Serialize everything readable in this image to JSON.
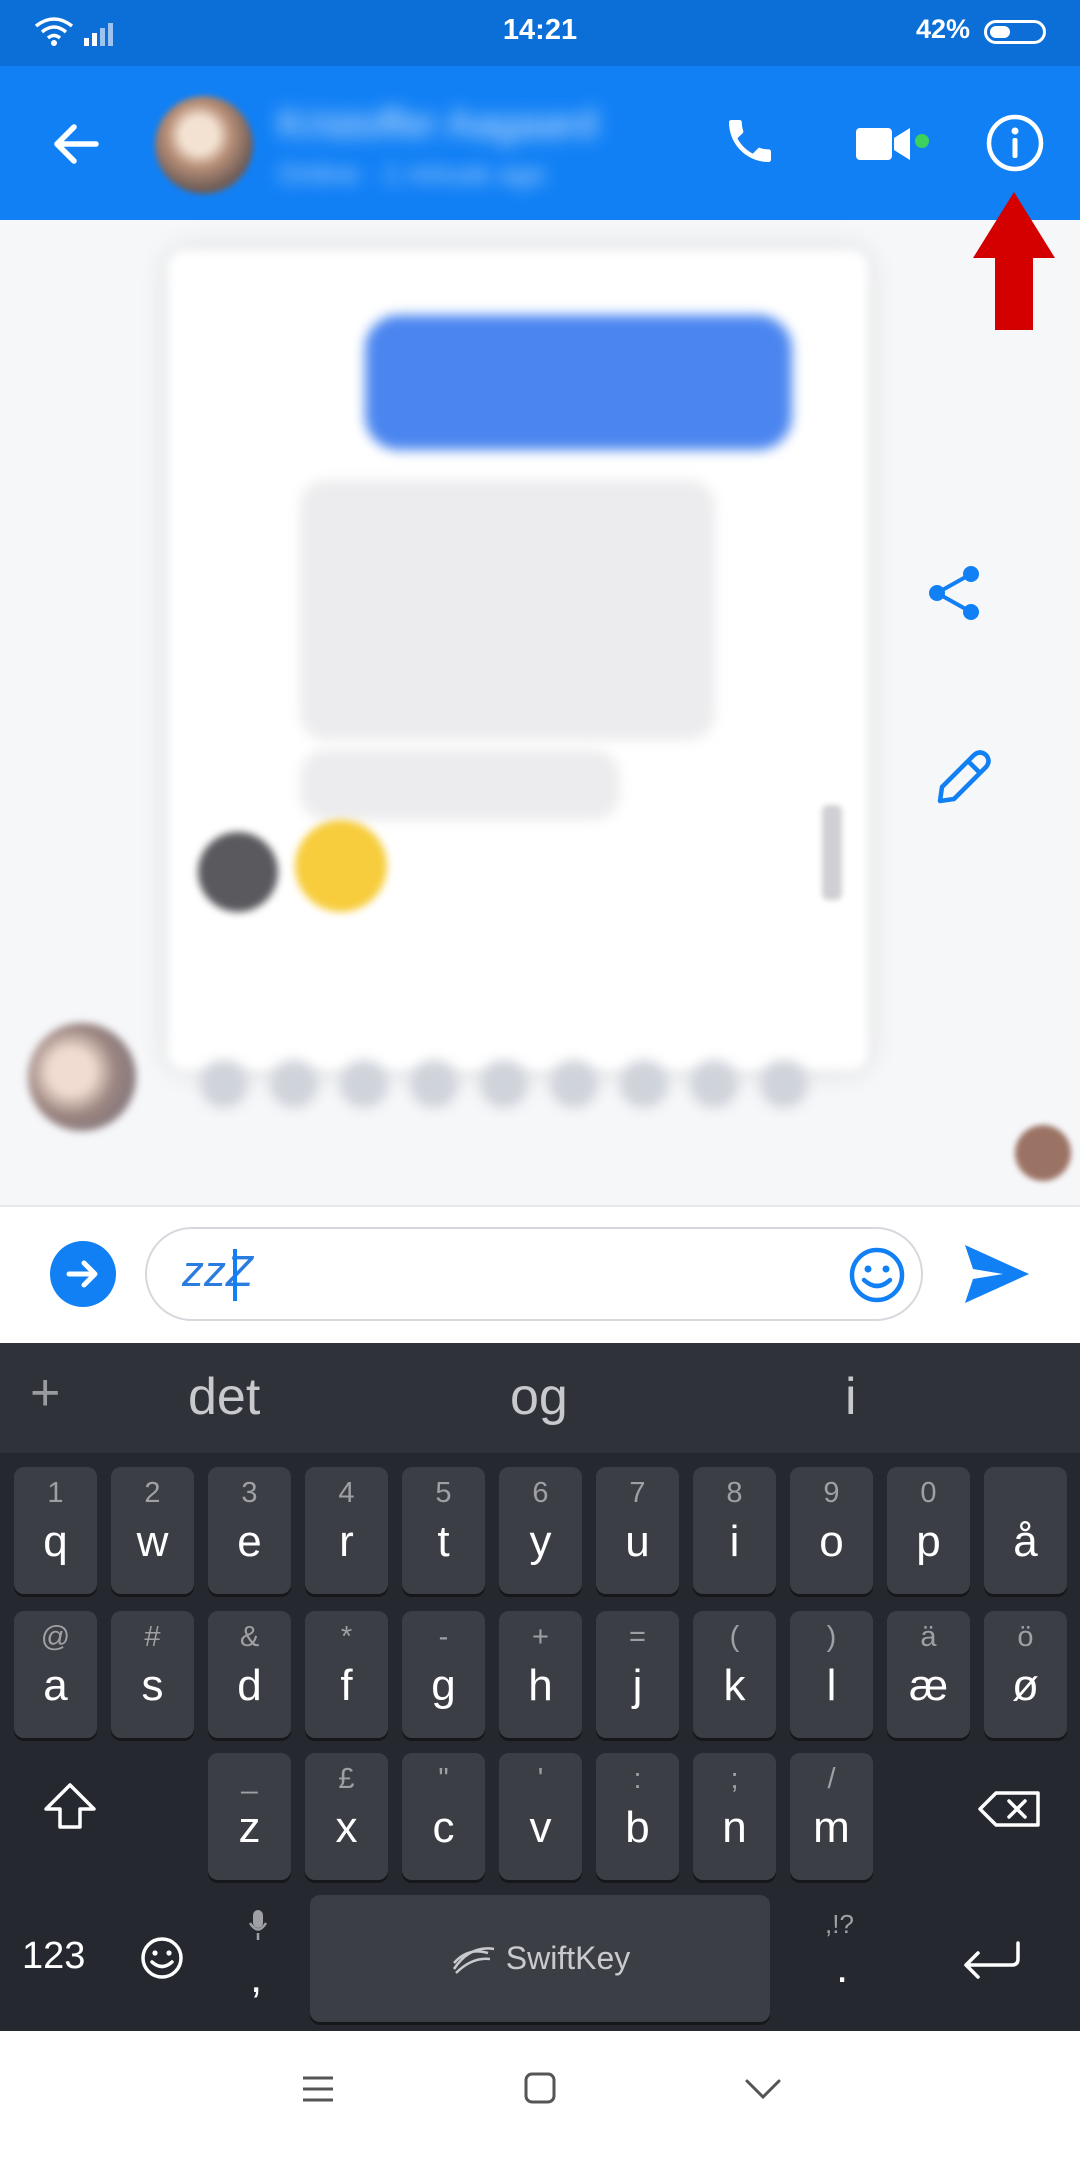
{
  "status_bar": {
    "time": "14:21",
    "battery": "42%"
  },
  "header": {
    "contact_name": "Kristoffer Aagaard",
    "contact_status": "Online · 1 minute ago"
  },
  "composer": {
    "text": "zzZ"
  },
  "keyboard": {
    "suggestions": [
      "det",
      "og",
      "i"
    ],
    "row1": [
      {
        "hint": "1",
        "key": "q"
      },
      {
        "hint": "2",
        "key": "w"
      },
      {
        "hint": "3",
        "key": "e"
      },
      {
        "hint": "4",
        "key": "r"
      },
      {
        "hint": "5",
        "key": "t"
      },
      {
        "hint": "6",
        "key": "y"
      },
      {
        "hint": "7",
        "key": "u"
      },
      {
        "hint": "8",
        "key": "i"
      },
      {
        "hint": "9",
        "key": "o"
      },
      {
        "hint": "0",
        "key": "p"
      },
      {
        "hint": "",
        "key": "å"
      }
    ],
    "row2": [
      {
        "hint": "@",
        "key": "a"
      },
      {
        "hint": "#",
        "key": "s"
      },
      {
        "hint": "&",
        "key": "d"
      },
      {
        "hint": "*",
        "key": "f"
      },
      {
        "hint": "-",
        "key": "g"
      },
      {
        "hint": "+",
        "key": "h"
      },
      {
        "hint": "=",
        "key": "j"
      },
      {
        "hint": "(",
        "key": "k"
      },
      {
        "hint": ")",
        "key": "l"
      },
      {
        "hint": "ä",
        "key": "æ"
      },
      {
        "hint": "ö",
        "key": "ø"
      }
    ],
    "row3": [
      {
        "hint": "_",
        "key": "z"
      },
      {
        "hint": "£",
        "key": "x"
      },
      {
        "hint": "\"",
        "key": "c"
      },
      {
        "hint": "'",
        "key": "v"
      },
      {
        "hint": ":",
        "key": "b"
      },
      {
        "hint": ";",
        "key": "n"
      },
      {
        "hint": "/",
        "key": "m"
      }
    ],
    "numbers_label": "123",
    "comma": ",",
    "period": ".",
    "period_hint": ",!?",
    "space_label": "SwiftKey"
  },
  "colors": {
    "brand": "#1180f5",
    "annotation_arrow": "#d40000",
    "keyboard_bg": "#262830"
  }
}
